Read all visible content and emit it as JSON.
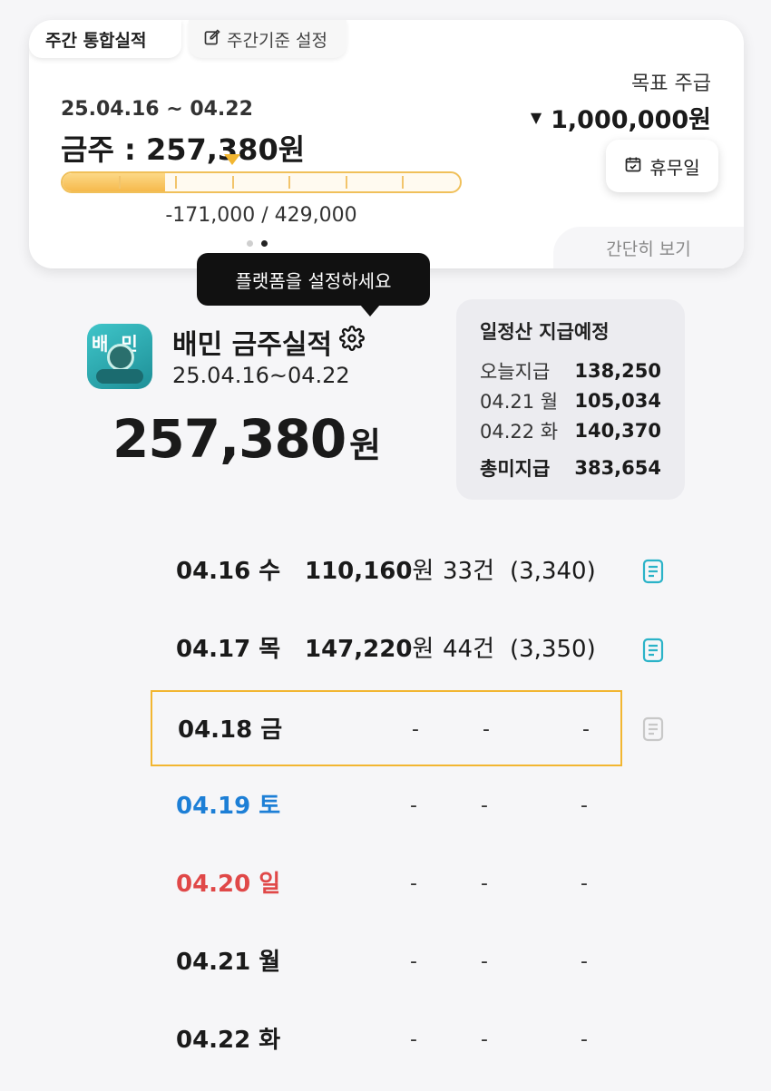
{
  "card": {
    "tab_weekly": "주간 통합실적",
    "tab_setting": "주간기준 설정",
    "range": "25.04.16 ~ 04.22",
    "this_week": "금주 : 257,380원",
    "goal_label": "목표 주급",
    "goal_value": "1,000,000원",
    "holiday_button": "휴무일",
    "progress_fraction": 0.257,
    "progress_text": "-171,000 / 429,000",
    "simple_view": "간단히 보기",
    "page_dots": {
      "count": 2,
      "active": 2
    }
  },
  "tooltip": "플랫폼을 설정하세요",
  "platform": {
    "title": "배민 금주실적",
    "range": "25.04.16~04.22",
    "total": "257,380",
    "total_unit": "원",
    "icon_text": "배민"
  },
  "payout": {
    "title": "일정산 지급예정",
    "rows": [
      {
        "label": "오늘지급",
        "value": "138,250"
      },
      {
        "label": "04.21 월",
        "value": "105,034"
      },
      {
        "label": "04.22 화",
        "value": "140,370"
      }
    ],
    "total_label": "총미지급",
    "total_value": "383,654"
  },
  "days": [
    {
      "date": "04.16 수",
      "amount": "110,160",
      "unit": "원",
      "count": "33건",
      "avg": "(3,340)"
    },
    {
      "date": "04.17 목",
      "amount": "147,220",
      "unit": "원",
      "count": "44건",
      "avg": "(3,350)"
    },
    {
      "date": "04.18 금",
      "dash": "-"
    },
    {
      "date": "04.19 토",
      "dash": "-"
    },
    {
      "date": "04.20 일",
      "dash": "-"
    },
    {
      "date": "04.21 월",
      "dash": "-"
    },
    {
      "date": "04.22 화",
      "dash": "-"
    }
  ],
  "colors": {
    "accent": "#f2b631",
    "saturday": "#1d7fd6",
    "sunday": "#e04848",
    "doc_active": "#2bb3c8",
    "doc_inactive": "#c8c8c8"
  }
}
